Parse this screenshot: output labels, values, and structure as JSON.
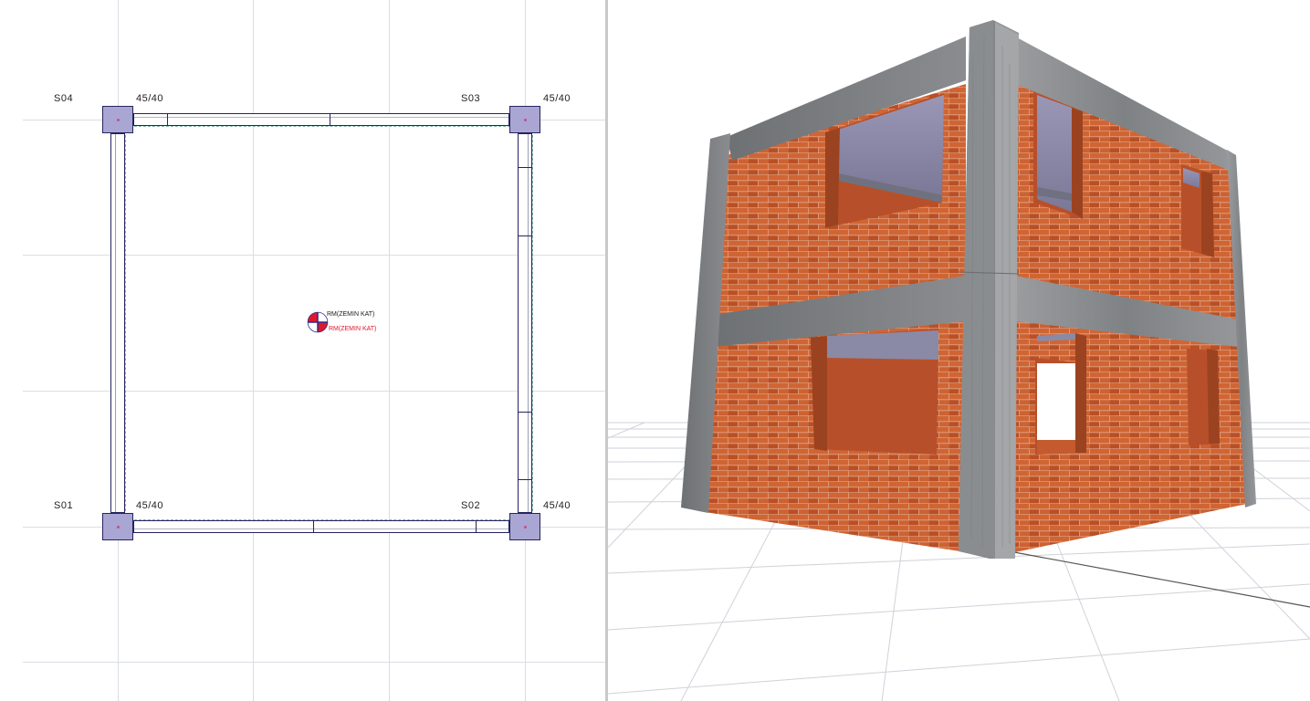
{
  "plan": {
    "columns": [
      {
        "id": "S04",
        "size": "45/40"
      },
      {
        "id": "S03",
        "size": "45/40"
      },
      {
        "id": "S01",
        "size": "45/40"
      },
      {
        "id": "S02",
        "size": "45/40"
      }
    ],
    "room_marker": {
      "label_top": "RM(ZEMIN KAT)",
      "label_bottom": "RM(ZEMIN KAT)"
    }
  },
  "colors": {
    "column_fill": "#a9a6d4",
    "beam_line": "#26235f",
    "grid": "#d9dde3",
    "brick": "#c0532c",
    "concrete": "#8c8f92",
    "glass": "#8a8aa6",
    "marker_red": "#e0182b"
  },
  "icons": {
    "room_marker": "room-marker-icon"
  }
}
